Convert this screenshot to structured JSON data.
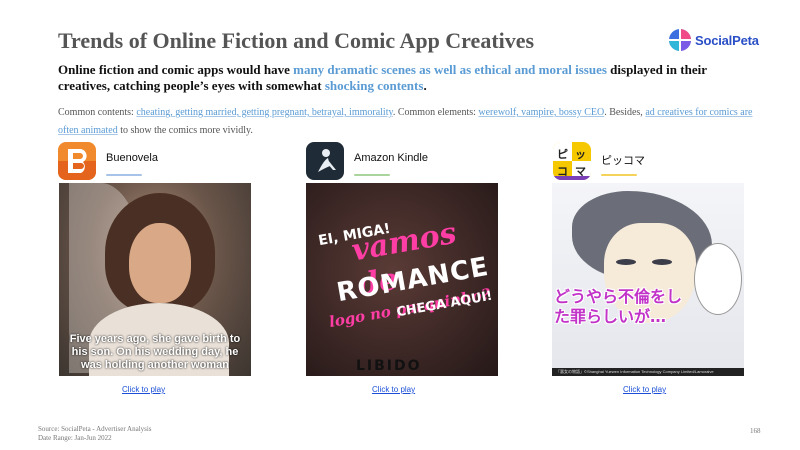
{
  "title": "Trends of Online Fiction and Comic App Creatives",
  "logo": {
    "text": "SocialPeta"
  },
  "headline": {
    "part1": "Online fiction and comic apps would have ",
    "hl1": "many dramatic scenes as well as ethical and moral issues",
    "part2": " displayed in their creatives, catching people’s eyes with somewhat ",
    "hl2": "shocking contents",
    "part3": "."
  },
  "contents": {
    "lead1": "Common contents: ",
    "items1": "cheating, getting married, getting pregnant, betrayal, immorality",
    "mid": ". Common elements: ",
    "items2": "werewolf, vampire, bossy CEO",
    "mid2": ". Besides, ",
    "items3": "ad creatives for comics are often animated",
    "tail": " to show the comics more vividly."
  },
  "cards": [
    {
      "name": "Buenovela",
      "line_color": "#a7c4e8",
      "icon_color": "#f08a2c",
      "creative_caption": "Five years ago, she gave birth to his son. On his wedding day, he was holding another woman",
      "link": "Click to play"
    },
    {
      "name": "Amazon Kindle",
      "line_color": "#a9d49b",
      "icon_color": "#1f2b36",
      "creative_texts": {
        "t1": "EI, MIGA!",
        "t2": "vamos de",
        "t3": "ROMANCE",
        "t4": "logo no parquinho?",
        "t5": "CHEGA AQUI!",
        "brand": "LIBIDO"
      },
      "link": "Click to play"
    },
    {
      "name": "ピッコマ",
      "line_color": "#f5d35a",
      "icon_color": "#f6c800",
      "creative_texts": {
        "jp": "どうやら不倫をした罪らしいが…",
        "foot": "「悪女の物語」©Shanghai Yuewen Information Technology Company Limited/Lamoraive"
      },
      "link": "Click to play"
    }
  ],
  "footer": {
    "source": "Source: SocialPeta - Advertiser Analysis",
    "date_range": "Date Range: Jan-Jun 2022"
  },
  "page_number": "168"
}
